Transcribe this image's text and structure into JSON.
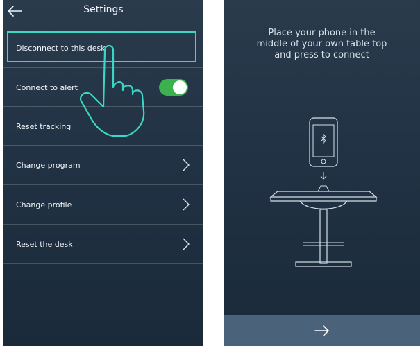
{
  "settings": {
    "title": "Settings",
    "rows": [
      {
        "label": "Disconnect to this desk"
      },
      {
        "label": "Connect to alert",
        "toggle_on": true
      },
      {
        "label": "Reset tracking"
      },
      {
        "label": "Change program"
      },
      {
        "label": "Change profile"
      },
      {
        "label": "Reset the desk"
      }
    ],
    "accent_color": "#3ad8c4",
    "toggle_color": "#3cb24e"
  },
  "connect": {
    "instruction_lines": [
      "Place your phone in the",
      "middle of your own table top",
      "and press to connect"
    ],
    "icons": [
      "phone-icon",
      "bluetooth-icon",
      "down-arrow-icon",
      "desk-icon",
      "next-arrow-icon"
    ]
  }
}
